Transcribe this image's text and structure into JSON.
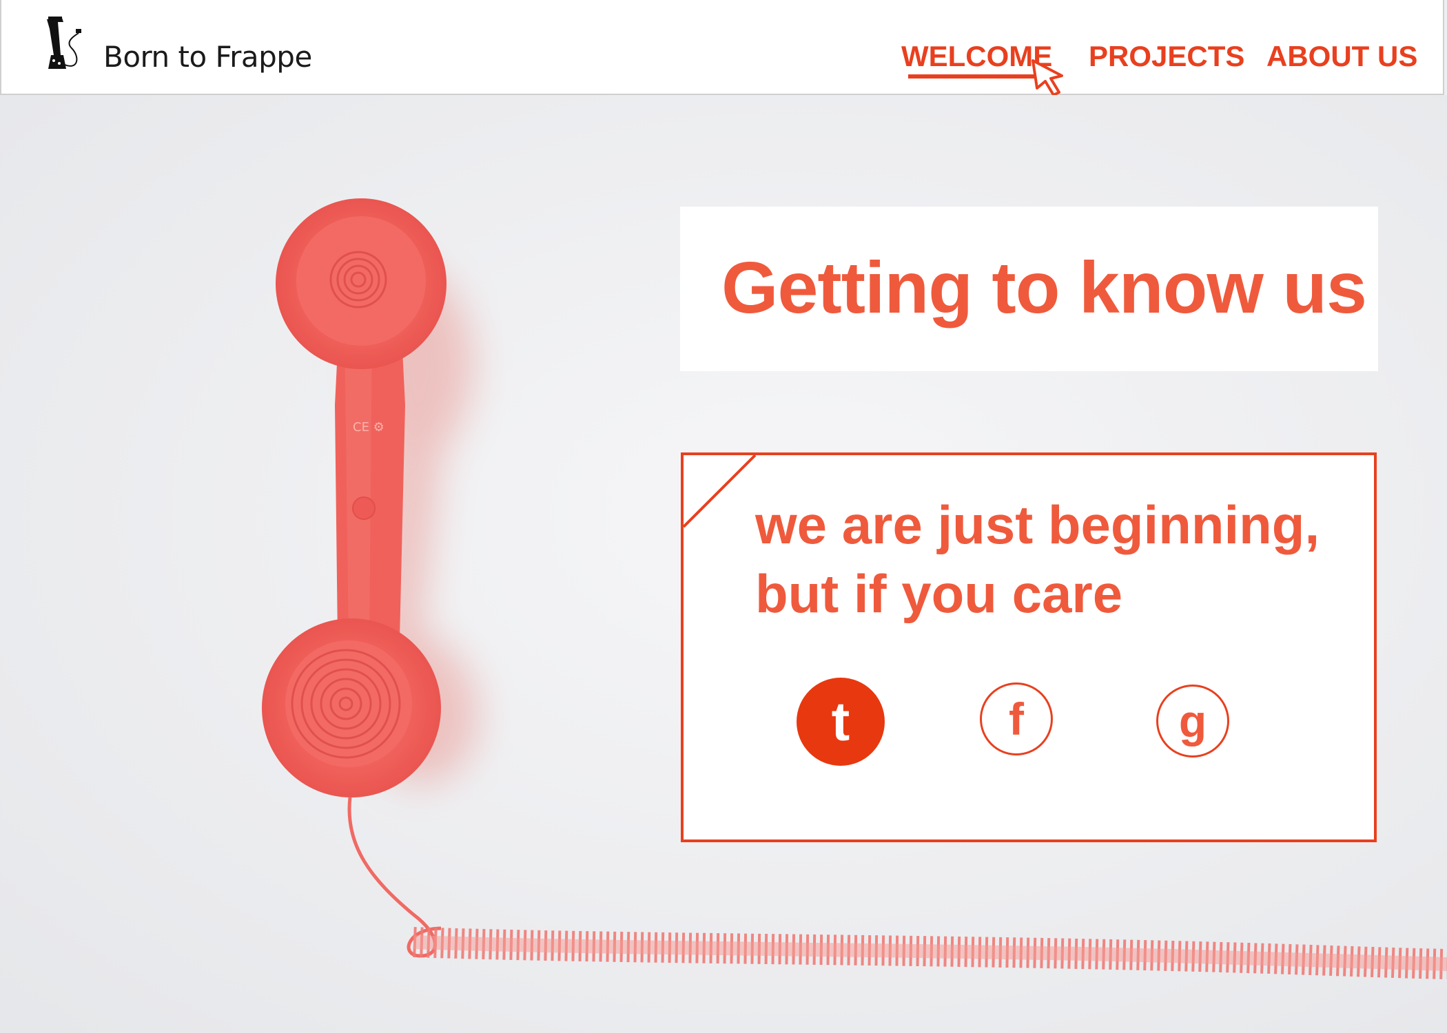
{
  "header": {
    "brand": "Born to Frappe",
    "nav": {
      "welcome": "WELCOME",
      "projects": "PROJECTS",
      "about": "ABOUT US"
    },
    "active_nav": "WELCOME"
  },
  "hero": {
    "title": "Getting to know us",
    "message_line1": "we are just beginning,",
    "message_line2": "but if you care",
    "social": {
      "tumblr": "t",
      "facebook": "f",
      "google": "g"
    }
  },
  "colors": {
    "accent": "#e8401f",
    "text_accent": "#ef5a3c",
    "phone": "#f2625e",
    "background": "#eeeff2"
  },
  "icons": [
    "blender-logo-icon",
    "mouse-cursor-icon",
    "tumblr-icon",
    "facebook-icon",
    "google-icon"
  ]
}
